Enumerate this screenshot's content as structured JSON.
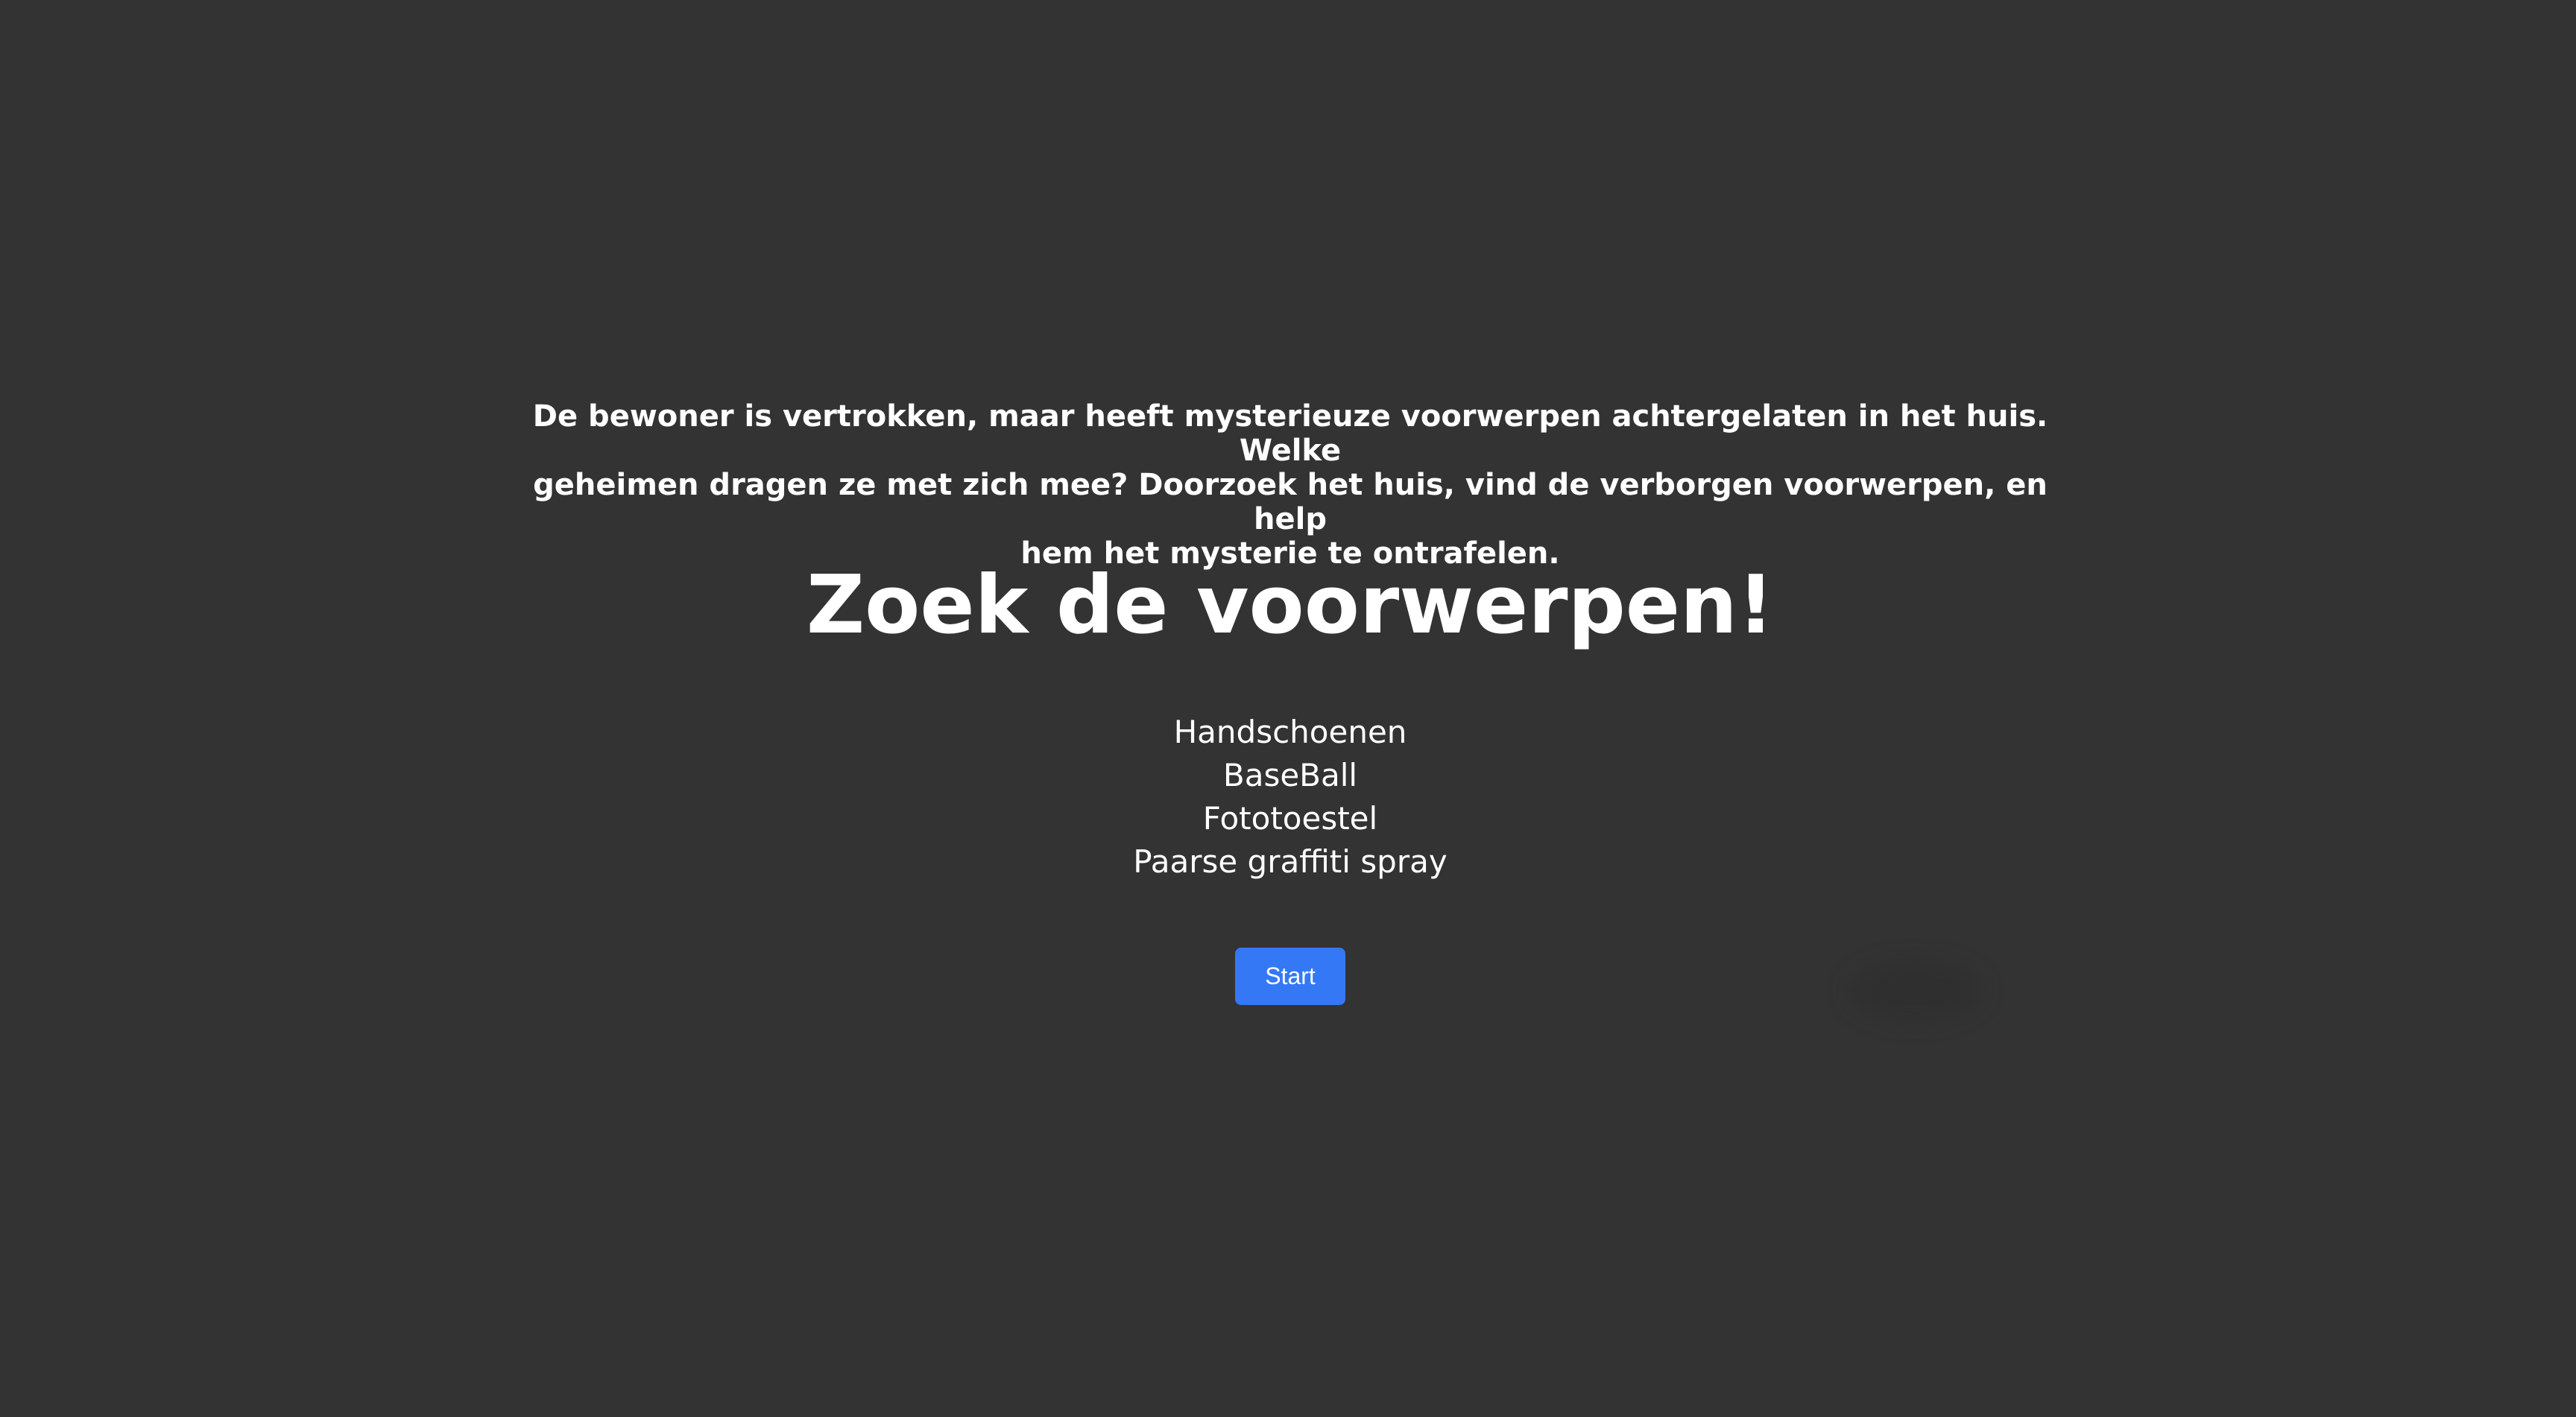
{
  "intro": {
    "story_line_1": "De bewoner is vertrokken, maar heeft mysterieuze voorwerpen achtergelaten in het huis. Welke",
    "story_line_2": "geheimen dragen ze met zich mee? Doorzoek het huis, vind de verborgen voorwerpen, en help",
    "story_line_3": "hem het mysterie te ontrafelen.",
    "title": "Zoek de voorwerpen!",
    "items": [
      "Handschoenen",
      "BaseBall",
      "Fototoestel",
      "Paarse graffiti spray"
    ],
    "start_label": "Start"
  },
  "colors": {
    "background": "#333333",
    "text": "#ffffff",
    "button": "#3478f6"
  }
}
